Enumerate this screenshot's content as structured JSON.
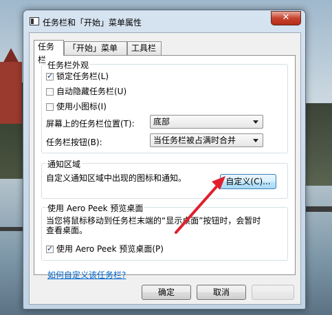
{
  "window": {
    "title": "任务栏和「开始」菜单属性",
    "close_glyph": "✕"
  },
  "tabs": [
    {
      "label": "任务栏",
      "active": true
    },
    {
      "label": "「开始」菜单",
      "active": false
    },
    {
      "label": "工具栏",
      "active": false
    }
  ],
  "appearance": {
    "group_title": "任务栏外观",
    "lock_taskbar": {
      "label": "锁定任务栏(L)",
      "checked": true
    },
    "auto_hide": {
      "label": "自动隐藏任务栏(U)",
      "checked": false
    },
    "small_icons": {
      "label": "使用小图标(I)",
      "checked": false
    },
    "location_label": "屏幕上的任务栏位置(T):",
    "location_value": "底部",
    "buttons_label": "任务栏按钮(B):",
    "buttons_value": "当任务栏被占满时合并"
  },
  "notification": {
    "group_title": "通知区域",
    "description": "自定义通知区域中出现的图标和通知。",
    "customize_button": "自定义(C)..."
  },
  "peek": {
    "group_title": "使用 Aero Peek 预览桌面",
    "description_line1": "当您将鼠标移动到任务栏末端的“显示桌面”按钮时，会暂时",
    "description_line2": "查看桌面。",
    "use_peek": {
      "label": "使用 Aero Peek 预览桌面(P)",
      "checked": true
    }
  },
  "help_link": "如何自定义该任务栏?",
  "footer": {
    "ok": "确定",
    "cancel": "取消"
  },
  "colors": {
    "annotation_arrow": "#e0202e",
    "link": "#0066cc"
  }
}
